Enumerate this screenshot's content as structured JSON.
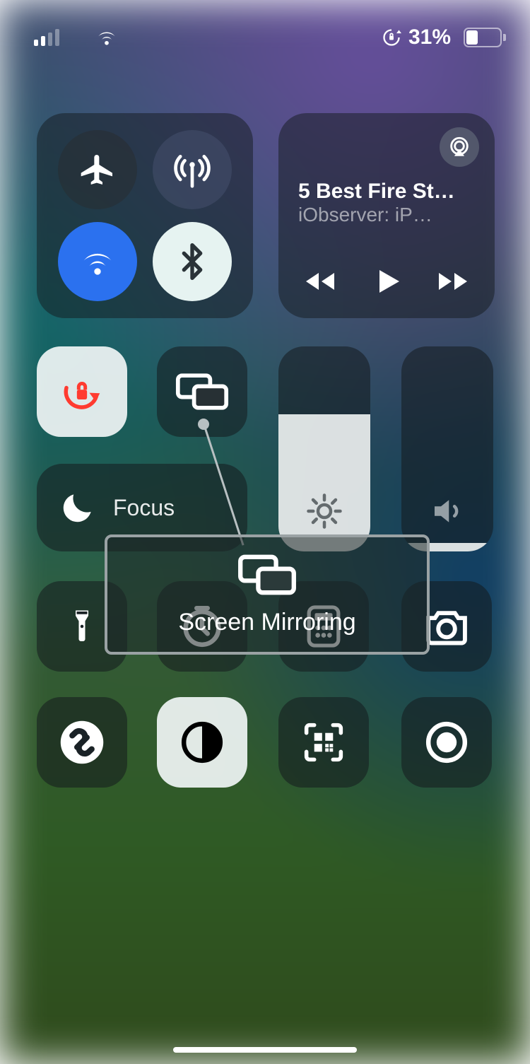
{
  "status": {
    "cell_bars_active": 2,
    "cell_bars_total": 4,
    "battery_percent_label": "31%",
    "battery_fill_percent": 31
  },
  "connectivity": {
    "airplane": false,
    "cellular": true,
    "wifi": true,
    "bluetooth": true
  },
  "media": {
    "title": "5 Best Fire St…",
    "subtitle": "iObserver: iP…"
  },
  "focus": {
    "label": "Focus"
  },
  "brightness": {
    "value_percent": 67
  },
  "volume": {
    "value_percent": 4
  },
  "callout": {
    "label": "Screen Mirroring"
  },
  "tiles": {
    "orientation_lock_active": true,
    "dark_mode_active": true
  }
}
